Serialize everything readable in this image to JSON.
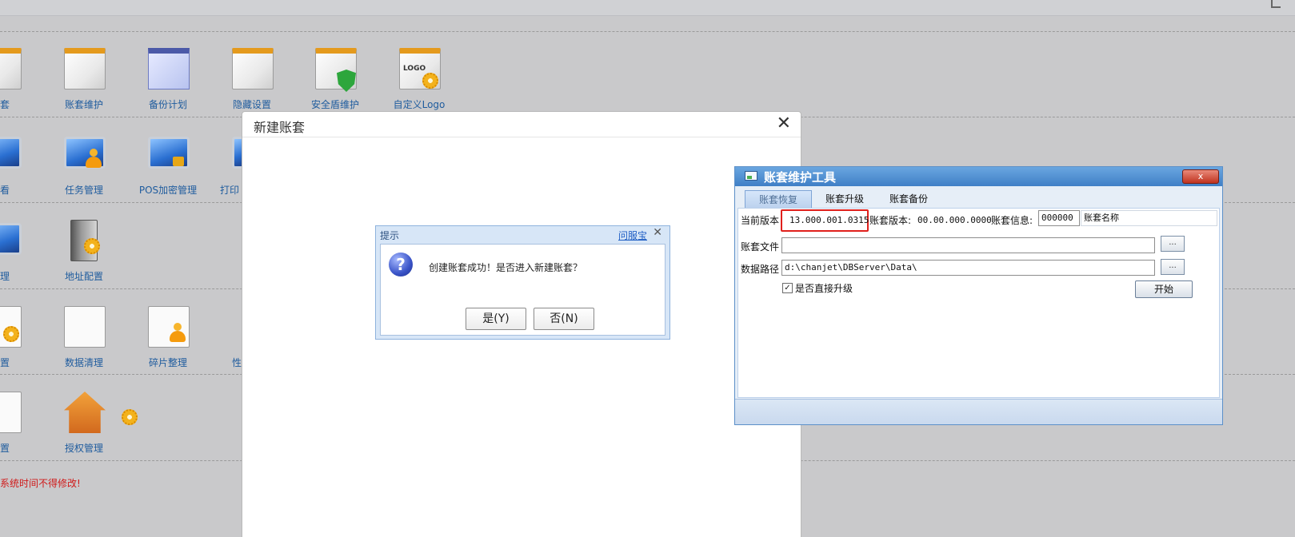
{
  "tiles": {
    "row1": [
      "账套",
      "账套维护",
      "备份计划",
      "隐藏设置",
      "安全盾维护",
      "自定义Logo"
    ],
    "row2": [
      "查看",
      "任务管理",
      "POS加密管理",
      "打印"
    ],
    "row3": [
      "管理",
      "地址配置"
    ],
    "row4": [
      "配置",
      "数据清理",
      "碎片整理",
      "性"
    ],
    "row5": [
      "设置",
      "授权管理"
    ]
  },
  "warning": "系统时间不得修改!",
  "logo_text": "LOGO",
  "modal": {
    "title": "新建账套",
    "close": "✕"
  },
  "prompt": {
    "title": "提示",
    "help_link": "问服宝",
    "close": "✕",
    "icon": "?",
    "message": "创建账套成功！是否进入新建账套？",
    "yes": "是(Y)",
    "no": "否(N)"
  },
  "tool": {
    "title": "账套维护工具",
    "close": "x",
    "tabs": [
      "账套恢复",
      "账套升级",
      "账套备份"
    ],
    "active_tab": "账套恢复",
    "current_version_label": "当前版本",
    "current_version": "13.000.001.0315",
    "set_version_label": "账套版本:",
    "set_version": "00.00.000.0000",
    "set_info_label": "账套信息:",
    "set_info_code": "000000",
    "set_name": "账套名称",
    "file_label": "账套文件",
    "file_value": "",
    "path_label": "数据路径",
    "path_value": "d:\\chanjet\\DBServer\\Data\\",
    "browse": "...",
    "direct_upgrade_label": "是否直接升级",
    "direct_upgrade_checked": "✓",
    "start": "开始"
  }
}
